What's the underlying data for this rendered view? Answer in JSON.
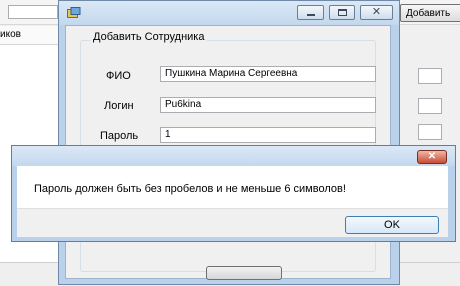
{
  "background_app": {
    "top_right_button_label": "Добавить",
    "left_column_header": "иков"
  },
  "dialog": {
    "title": "",
    "icon": "app-icon",
    "window_buttons": {
      "minimize": "minimize-icon",
      "maximize": "maximize-icon",
      "close_glyph": "✕"
    },
    "group_title": "Добавить Сотрудника",
    "fields": {
      "fio": {
        "label": "ФИО",
        "value": "Пушкина Марина Сергеевна"
      },
      "login": {
        "label": "Логин",
        "value": "Pu6kina"
      },
      "password": {
        "label": "Пароль",
        "value": "1"
      }
    }
  },
  "message_box": {
    "title": "",
    "close_glyph": "✕",
    "text": "Пароль должен быть без пробелов и не меньше 6 символов!",
    "ok_label": "OK"
  },
  "colors": {
    "titlebar": "#c3d8ee",
    "close_button": "#c94b34",
    "ok_border": "#3c7fb1"
  }
}
